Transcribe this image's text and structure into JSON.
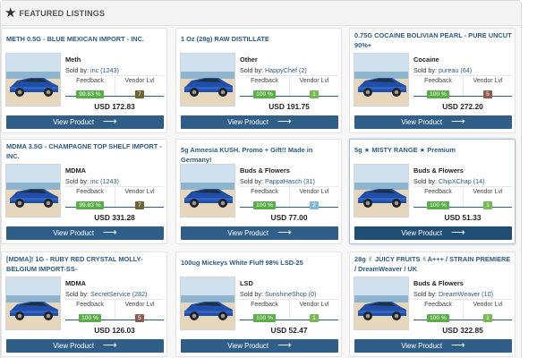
{
  "header": {
    "title": "FEATURED LISTINGS",
    "icon": "star-icon"
  },
  "button_label": "View Product",
  "listings": [
    {
      "title": "METH 0.5G - BLUE MEXICAN IMPORT - INC.",
      "category": "Meth",
      "sold_by": "Sold by:",
      "vendor": "inc (1243)",
      "feedback_label": "Feedback",
      "feedback": "99.83 %",
      "level_label": "Vendor Lvl",
      "level": "7",
      "price": "USD 172.83"
    },
    {
      "title": "1 Oz (28g) RAW DISTILLATE",
      "category": "Other",
      "sold_by": "Sold by:",
      "vendor": "HappyChef (2)",
      "feedback_label": "Feedback",
      "feedback": "100 %",
      "level_label": "Vendor Lvl",
      "level": "1",
      "price": "USD 191.75"
    },
    {
      "title": "0.75G COCAINE BOLIVIAN PEARL - PURE UNCUT 90%+",
      "category": "Cocaine",
      "sold_by": "Sold by:",
      "vendor": "pureau (64)",
      "feedback_label": "Feedback",
      "feedback": "100 %",
      "level_label": "Vendor Lvl",
      "level": "5",
      "price": "USD 272.20"
    },
    {
      "title": "MDMA 3.5G - CHAMPAGNE TOP SHELF IMPORT - INC.",
      "category": "MDMA",
      "sold_by": "Sold by:",
      "vendor": "inc (1243)",
      "feedback_label": "Feedback",
      "feedback": "99.83 %",
      "level_label": "Vendor Lvl",
      "level": "7",
      "price": "USD 331.28"
    },
    {
      "title": "5g Amnesia KUSH. Promo + Gift!! Made in Germany!",
      "category": "Buds & Flowers",
      "sold_by": "Sold by:",
      "vendor": "PappaHasch (31)",
      "feedback_label": "Feedback",
      "feedback": "100 %",
      "level_label": "Vendor Lvl",
      "level": "2",
      "price": "USD 77.00"
    },
    {
      "title": "5g ★ MISTY RANGE ★ Premium",
      "category": "Buds & Flowers",
      "sold_by": "Sold by:",
      "vendor": "ChipXChap (14)",
      "feedback_label": "Feedback",
      "feedback": "100 %",
      "level_label": "Vendor Lvl",
      "level": "1",
      "price": "USD 51.33"
    },
    {
      "title": "[MDMA]! 1G - RUBY RED CRYSTAL MOLLY-BELGIUM IMPORT-SS-",
      "category": "MDMA",
      "sold_by": "Sold by:",
      "vendor": "SecretService (282)",
      "feedback_label": "Feedback",
      "feedback": "100 %",
      "level_label": "Vendor Lvl",
      "level": "5",
      "price": "USD 126.03"
    },
    {
      "title": "100ug Mickeys White Fluff 98% LSD-25",
      "category": "LSD",
      "sold_by": "Sold by:",
      "vendor": "SunshineShop (0)",
      "feedback_label": "Feedback",
      "feedback": "100 %",
      "level_label": "Vendor Lvl",
      "level": "1",
      "price": "USD 52.47"
    },
    {
      "title": "28g ✌ JUICY FRUITS ✌A+++ / STRAIN PREMIERE / DreamWeaver / UK",
      "category": "Buds & Flowers",
      "sold_by": "Sold by:",
      "vendor": "DreamWeaver (10)",
      "feedback_label": "Feedback",
      "feedback": "100 %",
      "level_label": "Vendor Lvl",
      "level": "1",
      "price": "USD 322.85"
    }
  ]
}
